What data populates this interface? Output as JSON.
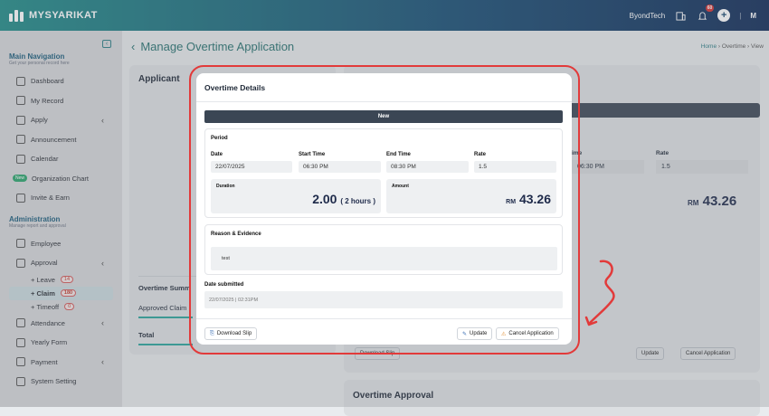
{
  "app": {
    "brand": "MYSYARIKAT",
    "company": "ByondTech",
    "notif_count": "60",
    "user_initial": "M"
  },
  "sidebar": {
    "main_title": "Main Navigation",
    "main_sub": "Get your personal record here",
    "items": [
      {
        "label": "Dashboard"
      },
      {
        "label": "My Record"
      },
      {
        "label": "Apply"
      },
      {
        "label": "Announcement"
      },
      {
        "label": "Calendar"
      },
      {
        "label": "Organization Chart",
        "tag": "New"
      },
      {
        "label": "Invite & Earn"
      }
    ],
    "admin_title": "Administration",
    "admin_sub": "Manage report and approval",
    "admin_items": [
      {
        "label": "Employee"
      },
      {
        "label": "Approval"
      }
    ],
    "sub_items": [
      {
        "label": "Leave",
        "count": "14"
      },
      {
        "label": "Claim",
        "count": "180"
      },
      {
        "label": "Timeoff",
        "count": "0"
      }
    ],
    "more_items": [
      {
        "label": "Attendance"
      },
      {
        "label": "Yearly Form"
      },
      {
        "label": "Payment"
      },
      {
        "label": "System Setting"
      }
    ]
  },
  "page": {
    "title": "Manage Overtime Application",
    "crumb_home": "Home",
    "crumb_mid": "Overtime",
    "crumb_last": "View",
    "applicant": "Applicant",
    "ot_summary": "Overtime Summ",
    "approved_claim": "Approved Claim",
    "total": "Total",
    "bg_time": "ime",
    "bg_rate": "Rate",
    "bg_start": "06:30 PM",
    "bg_rate_val": "1.5",
    "bg_rm": "RM",
    "bg_amount": "43.26",
    "bg_download": "Download Slip",
    "bg_update": "Update",
    "bg_cancel": "Cancel Application",
    "ot_approval": "Overtime Approval"
  },
  "modal": {
    "title": "Overtime Details",
    "status": "New",
    "period": "Period",
    "date_label": "Date",
    "date": "22/07/2025",
    "start_label": "Start Time",
    "start": "06:30 PM",
    "end_label": "End Time",
    "end": "08:30 PM",
    "rate_label": "Rate",
    "rate": "1.5",
    "duration_label": "Duration",
    "duration": "2.00",
    "duration_hours": "( 2 hours )",
    "amount_label": "Amount",
    "currency": "RM",
    "amount": "43.26",
    "reason_title": "Reason & Evidence",
    "reason": "test",
    "submitted_label": "Date submitted",
    "submitted": "22/07/2025 | 02:31PM",
    "download": "Download Slip",
    "update": "Update",
    "cancel": "Cancel Application"
  }
}
